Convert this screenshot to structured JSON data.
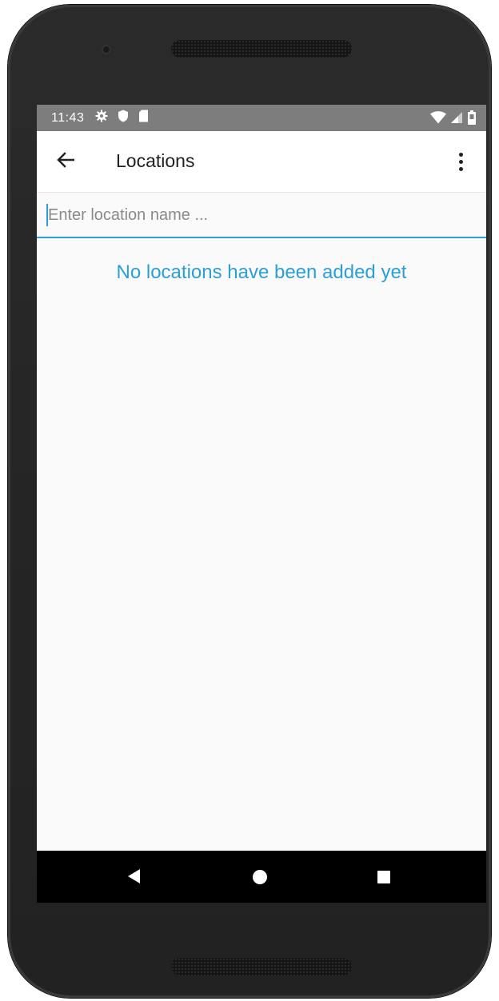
{
  "status_bar": {
    "time": "11:43",
    "icons_left": [
      "gear-icon",
      "shield-icon",
      "sd-card-icon"
    ],
    "icons_right": [
      "wifi-icon",
      "signal-icon",
      "battery-icon"
    ]
  },
  "app_bar": {
    "title": "Locations",
    "back_icon": "arrow-left-icon",
    "menu_icon": "more-vert-icon"
  },
  "search": {
    "placeholder": "Enter location name ...",
    "value": ""
  },
  "empty_state": {
    "message": "No locations have been added yet"
  },
  "nav_bar": {
    "buttons": [
      "back-triangle-icon",
      "home-circle-icon",
      "recents-square-icon"
    ]
  },
  "colors": {
    "accent": "#2a9fd8",
    "status_bar": "#7d7d7d",
    "app_bar": "#ffffff",
    "nav_bar": "#000000"
  }
}
